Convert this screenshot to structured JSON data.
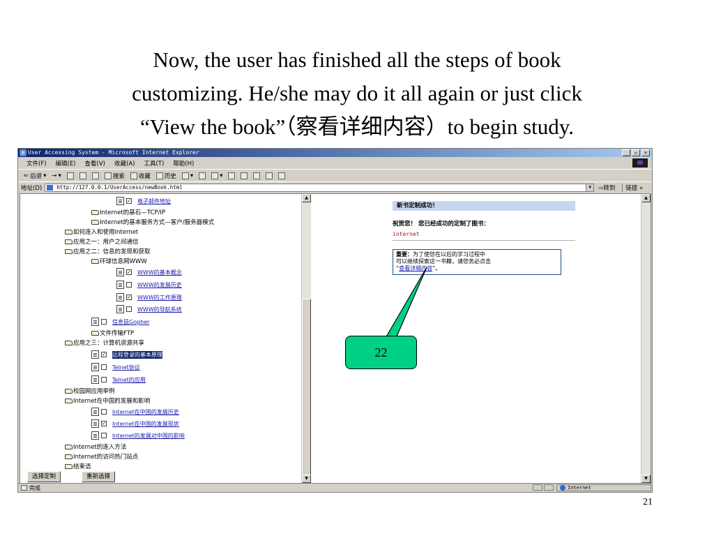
{
  "caption": {
    "line1": "Now, the user has finished all the steps of book",
    "line2": "customizing. He/she may do it all again or just click",
    "line3": "“View the book”（察看详细内容）to begin study."
  },
  "slide_number": "21",
  "window": {
    "title": "User Accessing System - Microsoft Internet Explorer",
    "menu": [
      "文件(F)",
      "编辑(E)",
      "查看(V)",
      "收藏(A)",
      "工具(T)",
      "帮助(H)"
    ],
    "toolbar": {
      "back": "后退",
      "forward": "→",
      "search": "搜索",
      "favorites": "收藏",
      "history": "历史"
    },
    "address": {
      "label": "地址(D)",
      "url": "http://127.0.0.1/UserAccess/newBook.html",
      "go": "转到",
      "links": "链接 »"
    },
    "status": {
      "done": "完成",
      "zone": "Internet"
    }
  },
  "tree": {
    "row1_link": "电子邮件地址",
    "tcpip": "Internet的基石—TCP/IP",
    "client_server": "Internet的基本服务方式—客户/服务器模式",
    "access": "如何连入和使用Internet",
    "app1": "应用之一：用户之间通信",
    "app2": "应用之二：信息的发现和获取",
    "www": "环球信息网WWW",
    "www_concept": "WWW的基本概念",
    "www_history": "WWW的发展历史",
    "www_principle": "WWW的工作原理",
    "www_nav": "WWW的导航系统",
    "gopher": "信息鼠Gopher",
    "ftp": "文件传输FTP",
    "app3": "应用之三：计算机资源共享",
    "remote_login": "远程登录的基本原理",
    "telnet_protocol": "Telnet协议",
    "telnet_app": "Telnet的应用",
    "campus": "校园网应用举例",
    "china": "Internet在中国的发展和影响",
    "china_history": "Internet在中国的发展历史",
    "china_status": "Internet在中国的发展现状",
    "china_impact": "Internet的发展对中国的影响",
    "access_methods": "Internet的连入方法",
    "hot_sites": "Internet的访问热门站点",
    "conclusion": "结束语",
    "btn_confirm": "选择定制",
    "btn_reselect": "重新选择"
  },
  "right": {
    "success_title": "新书定制成功！",
    "congrats": "祝贺您！ 您已经成功的定制了图书：",
    "book_name": "internet",
    "note_label": "重要：",
    "note_line1": "为了使您在以后的学习过程中",
    "note_line2": "可以继续探索这一书籍，请您务必点击",
    "note_open": "“",
    "note_link": "查看详细内容",
    "note_close": "”。"
  },
  "callout": {
    "label": "22",
    "fill": "#00d084"
  }
}
